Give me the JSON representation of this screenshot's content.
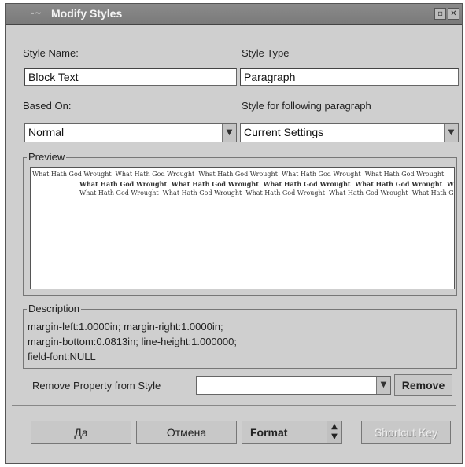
{
  "window": {
    "title": "Modify Styles"
  },
  "style_name": {
    "label": "Style Name:",
    "value": "Block Text"
  },
  "style_type": {
    "label": "Style Type",
    "value": "Paragraph"
  },
  "based_on": {
    "label": "Based On:",
    "value": "Normal"
  },
  "next_style": {
    "label": "Style for following paragraph",
    "value": "Current Settings"
  },
  "preview": {
    "label": "Preview",
    "sample_text": "What Hath God Wrought"
  },
  "description": {
    "label": "Description",
    "lines": [
      "margin-left:1.0000in; margin-right:1.0000in;",
      "margin-bottom:0.0813in; line-height:1.000000;",
      "field-font:NULL"
    ]
  },
  "remove_property": {
    "label": "Remove Property from Style",
    "value": "",
    "button": "Remove"
  },
  "buttons": {
    "ok": "Да",
    "cancel": "Отмена",
    "format": "Format",
    "shortcut": "Shortcut Key"
  }
}
